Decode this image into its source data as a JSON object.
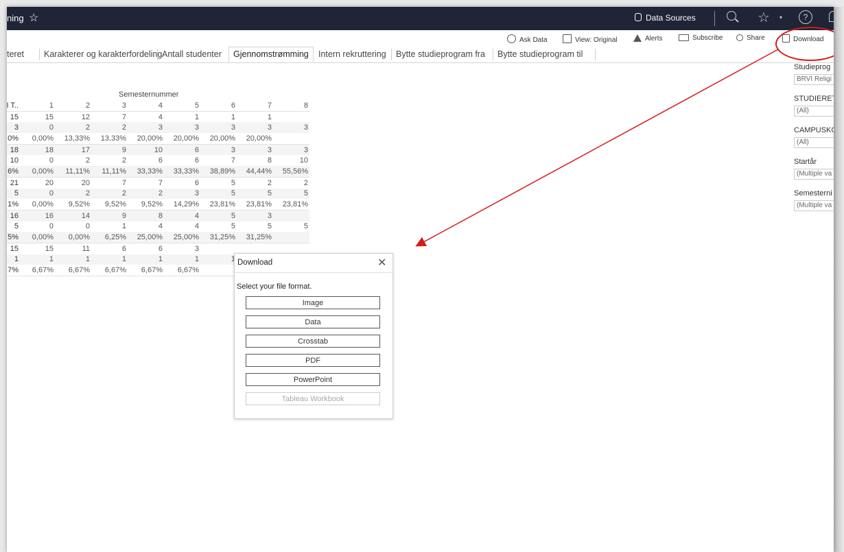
{
  "topbar": {
    "title_fragment": "ning",
    "star_glyph": "☆",
    "data_sources": "Data Sources",
    "fav_glyph": "☆",
    "caret": "▾",
    "help_glyph": "?"
  },
  "toolbar": {
    "ask_data": "Ask Data",
    "view_original": "View: Original",
    "alerts": "Alerts",
    "subscribe": "Subscribe",
    "share": "Share",
    "download": "Download"
  },
  "tabs": [
    "teret",
    "Karakterer og karakterfordeling",
    "Antall studenter",
    "Gjennomstrømming",
    "Intern rekruttering",
    "Bytte studieprogram fra",
    "Bytte studieprogram til"
  ],
  "active_tab": "Gjennomstrømming",
  "table": {
    "super_header": "Semesternummer",
    "header": [
      "I T..",
      "1",
      "2",
      "3",
      "4",
      "5",
      "6",
      "7",
      "8"
    ],
    "rows": [
      [
        "15",
        "15",
        "12",
        "7",
        "4",
        "1",
        "1",
        "1",
        ""
      ],
      [
        "3",
        "0",
        "2",
        "2",
        "3",
        "3",
        "3",
        "3",
        "3"
      ],
      [
        "0%",
        "0,00%",
        "13,33%",
        "13,33%",
        "20,00%",
        "20,00%",
        "20,00%",
        "20,00%",
        ""
      ],
      [
        "18",
        "18",
        "17",
        "9",
        "10",
        "6",
        "3",
        "3",
        "3"
      ],
      [
        "10",
        "0",
        "2",
        "2",
        "6",
        "6",
        "7",
        "8",
        "10"
      ],
      [
        "6%",
        "0,00%",
        "11,11%",
        "11,11%",
        "33,33%",
        "33,33%",
        "38,89%",
        "44,44%",
        "55,56%"
      ],
      [
        "21",
        "20",
        "20",
        "7",
        "7",
        "6",
        "5",
        "2",
        "2"
      ],
      [
        "5",
        "0",
        "2",
        "2",
        "2",
        "3",
        "5",
        "5",
        "5"
      ],
      [
        "1%",
        "0,00%",
        "9,52%",
        "9,52%",
        "9,52%",
        "14,29%",
        "23,81%",
        "23,81%",
        "23,81%"
      ],
      [
        "16",
        "16",
        "14",
        "9",
        "8",
        "4",
        "5",
        "3",
        ""
      ],
      [
        "5",
        "0",
        "0",
        "1",
        "4",
        "4",
        "5",
        "5",
        "5"
      ],
      [
        "5%",
        "0,00%",
        "0,00%",
        "6,25%",
        "25,00%",
        "25,00%",
        "31,25%",
        "31,25%",
        ""
      ],
      [
        "15",
        "15",
        "11",
        "6",
        "6",
        "3",
        "",
        "",
        ""
      ],
      [
        "1",
        "1",
        "1",
        "1",
        "1",
        "1",
        "1",
        "",
        ""
      ],
      [
        "7%",
        "6,67%",
        "6,67%",
        "6,67%",
        "6,67%",
        "6,67%",
        "",
        "",
        ""
      ]
    ]
  },
  "filters": [
    {
      "label": "Studieprog",
      "value": "BRVI Religi"
    },
    {
      "label": "STUDIERET",
      "value": "(All)"
    },
    {
      "label": "CAMPUSKO",
      "value": "(All)"
    },
    {
      "label": "Startår",
      "value": "(Multiple va"
    },
    {
      "label": "Semesterni",
      "value": "(Multiple va"
    }
  ],
  "dialog": {
    "title": "Download",
    "close_glyph": "✕",
    "prompt": "Select your file format.",
    "options": [
      {
        "label": "Image",
        "enabled": true
      },
      {
        "label": "Data",
        "enabled": true
      },
      {
        "label": "Crosstab",
        "enabled": true
      },
      {
        "label": "PDF",
        "enabled": true
      },
      {
        "label": "PowerPoint",
        "enabled": true
      },
      {
        "label": "Tableau Workbook",
        "enabled": false
      }
    ]
  },
  "colors": {
    "topbar": "#1f2436",
    "annotation_red": "#d61a1a",
    "border": "#d6d6d6"
  }
}
